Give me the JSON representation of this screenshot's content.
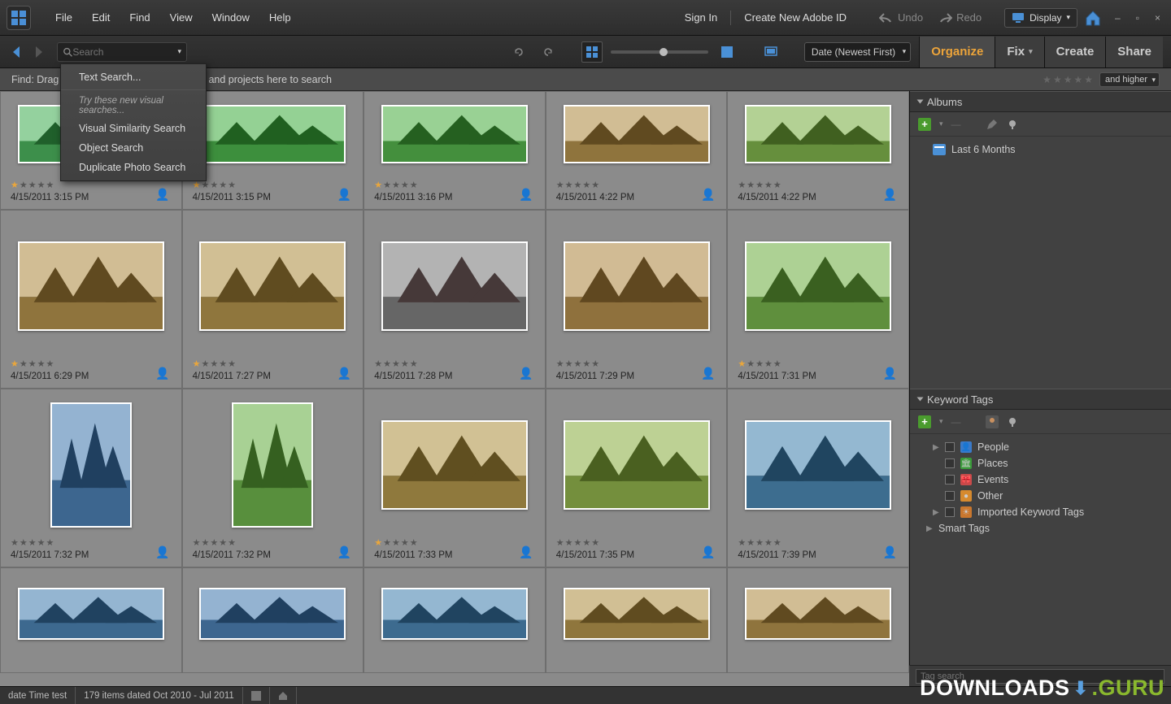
{
  "menubar": {
    "items": [
      "File",
      "Edit",
      "Find",
      "View",
      "Window",
      "Help"
    ],
    "sign_in": "Sign In",
    "create_id": "Create New Adobe ID",
    "undo": "Undo",
    "redo": "Redo",
    "display": "Display"
  },
  "toolbar": {
    "search_placeholder": "Search",
    "sort_label": "Date (Newest First)"
  },
  "tabs": {
    "organize": "Organize",
    "fix": "Fix",
    "create": "Create",
    "share": "Share"
  },
  "findbar": {
    "text": "Find: Drag tags, albums, keywords, videos, and projects here to search",
    "text_visible_prefix": "Find: Drag",
    "text_visible_suffix": "deos, and projects here to search",
    "higher": "and higher"
  },
  "search_menu": {
    "text_search": "Text Search...",
    "hint": "Try these new visual searches...",
    "visual": "Visual Similarity Search",
    "object": "Object Search",
    "duplicate": "Duplicate Photo Search"
  },
  "thumbs": [
    {
      "date": "4/15/2011 3:15 PM",
      "stars": 1,
      "orient": "wide-s",
      "hue": 130
    },
    {
      "date": "4/15/2011 3:15 PM",
      "stars": 1,
      "orient": "wide-s",
      "hue": 120
    },
    {
      "date": "4/15/2011 3:16 PM",
      "stars": 1,
      "orient": "wide-s",
      "hue": 115
    },
    {
      "date": "4/15/2011 4:22 PM",
      "stars": 0,
      "orient": "wide-s",
      "hue": 40
    },
    {
      "date": "4/15/2011 4:22 PM",
      "stars": 0,
      "orient": "wide-s",
      "hue": 90
    },
    {
      "date": "4/15/2011 6:29 PM",
      "stars": 1,
      "orient": "wide",
      "hue": 40
    },
    {
      "date": "4/15/2011 7:27 PM",
      "stars": 1,
      "orient": "wide",
      "hue": 42
    },
    {
      "date": "4/15/2011 7:28 PM",
      "stars": 0,
      "orient": "wide",
      "hue": 0
    },
    {
      "date": "4/15/2011 7:29 PM",
      "stars": 0,
      "orient": "wide",
      "hue": 38
    },
    {
      "date": "4/15/2011 7:31 PM",
      "stars": 1,
      "orient": "wide",
      "hue": 95
    },
    {
      "date": "4/15/2011 7:32 PM",
      "stars": 0,
      "orient": "tall",
      "hue": 210
    },
    {
      "date": "4/15/2011 7:32 PM",
      "stars": 0,
      "orient": "tall",
      "hue": 100
    },
    {
      "date": "4/15/2011 7:33 PM",
      "stars": 1,
      "orient": "wide",
      "hue": 44
    },
    {
      "date": "4/15/2011 7:35 PM",
      "stars": 0,
      "orient": "wide",
      "hue": 80
    },
    {
      "date": "4/15/2011 7:39 PM",
      "stars": 0,
      "orient": "wide",
      "hue": 205
    },
    {
      "date": "",
      "stars": -1,
      "orient": "wide",
      "hue": 208
    },
    {
      "date": "",
      "stars": -1,
      "orient": "wide",
      "hue": 210
    },
    {
      "date": "",
      "stars": -1,
      "orient": "wide",
      "hue": 206
    },
    {
      "date": "",
      "stars": -1,
      "orient": "wide",
      "hue": 42
    },
    {
      "date": "",
      "stars": -1,
      "orient": "wide",
      "hue": 40
    }
  ],
  "albums": {
    "title": "Albums",
    "item": "Last 6 Months"
  },
  "tags": {
    "title": "Keyword Tags",
    "people": "People",
    "places": "Places",
    "events": "Events",
    "other": "Other",
    "imported": "Imported Keyword Tags",
    "smart": "Smart Tags",
    "search_placeholder": "Tag search"
  },
  "status": {
    "left": "date Time test",
    "count": "179 items dated Oct 2010 - Jul 2011"
  },
  "watermark": {
    "a": "DOWNLOADS",
    "b": ".GURU"
  }
}
